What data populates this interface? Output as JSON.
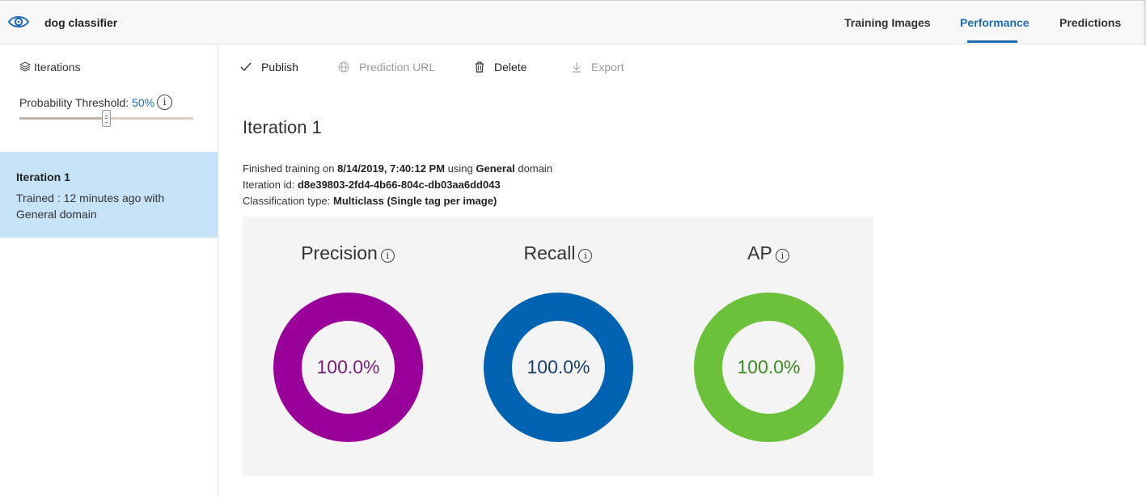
{
  "header": {
    "project_name": "dog classifier",
    "nav": [
      {
        "label": "Training Images",
        "active": false
      },
      {
        "label": "Performance",
        "active": true
      },
      {
        "label": "Predictions",
        "active": false
      }
    ],
    "logo_icon": "eye-icon",
    "accent_color": "#1f6bb5"
  },
  "sidebar": {
    "iterations_label": "Iterations",
    "threshold_label": "Probability Threshold:",
    "threshold_value": "50%",
    "threshold_fraction": 0.5,
    "info_glyph": "i",
    "iteration_card": {
      "title": "Iteration 1",
      "description": "Trained : 12 minutes ago with General domain"
    }
  },
  "toolbar": {
    "publish": {
      "label": "Publish",
      "icon": "check-icon",
      "enabled": true
    },
    "prediction_url": {
      "label": "Prediction URL",
      "icon": "globe-icon",
      "enabled": false
    },
    "delete": {
      "label": "Delete",
      "icon": "trash-icon",
      "enabled": true
    },
    "export": {
      "label": "Export",
      "icon": "download-icon",
      "enabled": false
    }
  },
  "main": {
    "title": "Iteration 1",
    "finished_prefix": "Finished training on ",
    "finished_date": "8/14/2019, 7:40:12 PM",
    "finished_mid": " using ",
    "finished_domain": "General",
    "finished_suffix": " domain",
    "iteration_id_label": "Iteration id: ",
    "iteration_id": "d8e39803-2fd4-4b66-804c-db03aa6dd043",
    "classification_label": "Classification type: ",
    "classification_value": "Multiclass (Single tag per image)"
  },
  "metrics": [
    {
      "label": "Precision",
      "value": "100.0%",
      "fraction": 1.0,
      "color": "#990099",
      "text_color": "#7a1c7a"
    },
    {
      "label": "Recall",
      "value": "100.0%",
      "fraction": 1.0,
      "color": "#0063b1",
      "text_color": "#1a3e6e"
    },
    {
      "label": "AP",
      "value": "100.0%",
      "fraction": 1.0,
      "color": "#6cc13a",
      "text_color": "#3d8a1f"
    }
  ]
}
